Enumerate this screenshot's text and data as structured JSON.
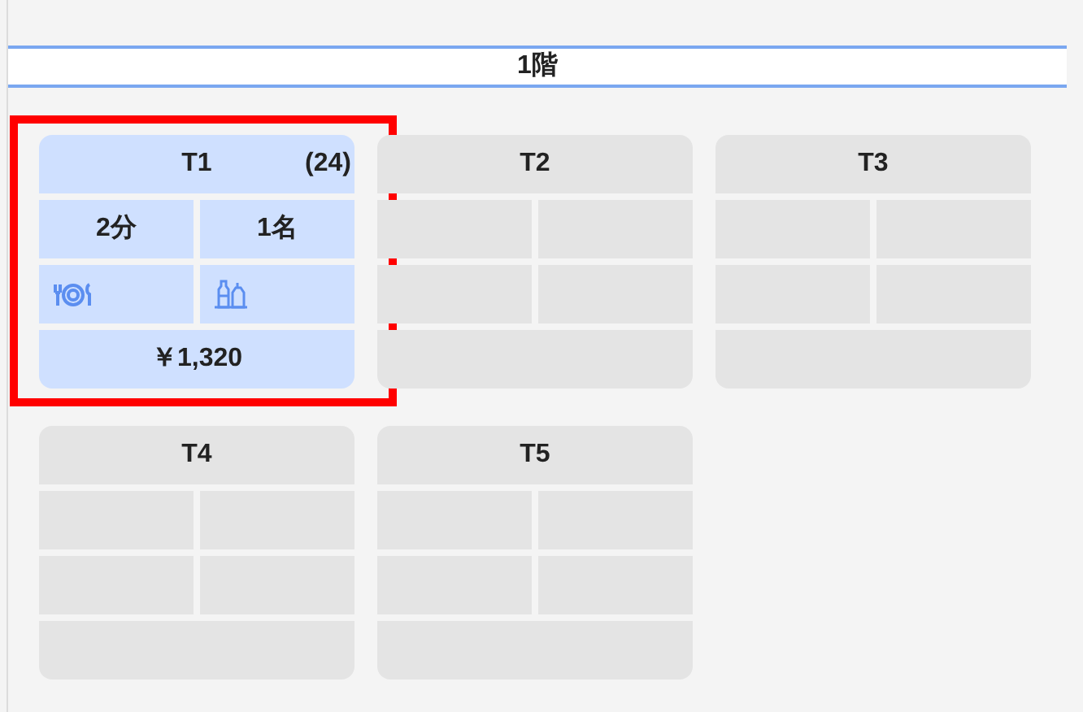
{
  "floor": {
    "title": "1階"
  },
  "tables": [
    {
      "name": "T1",
      "occupied": true,
      "highlighted": true,
      "count": "(24)",
      "elapsed": "2分",
      "guests": "1名",
      "total": "￥1,320"
    },
    {
      "name": "T2",
      "occupied": false,
      "highlighted": false
    },
    {
      "name": "T3",
      "occupied": false,
      "highlighted": false
    },
    {
      "name": "T4",
      "occupied": false,
      "highlighted": false
    },
    {
      "name": "T5",
      "occupied": false,
      "highlighted": false
    }
  ]
}
